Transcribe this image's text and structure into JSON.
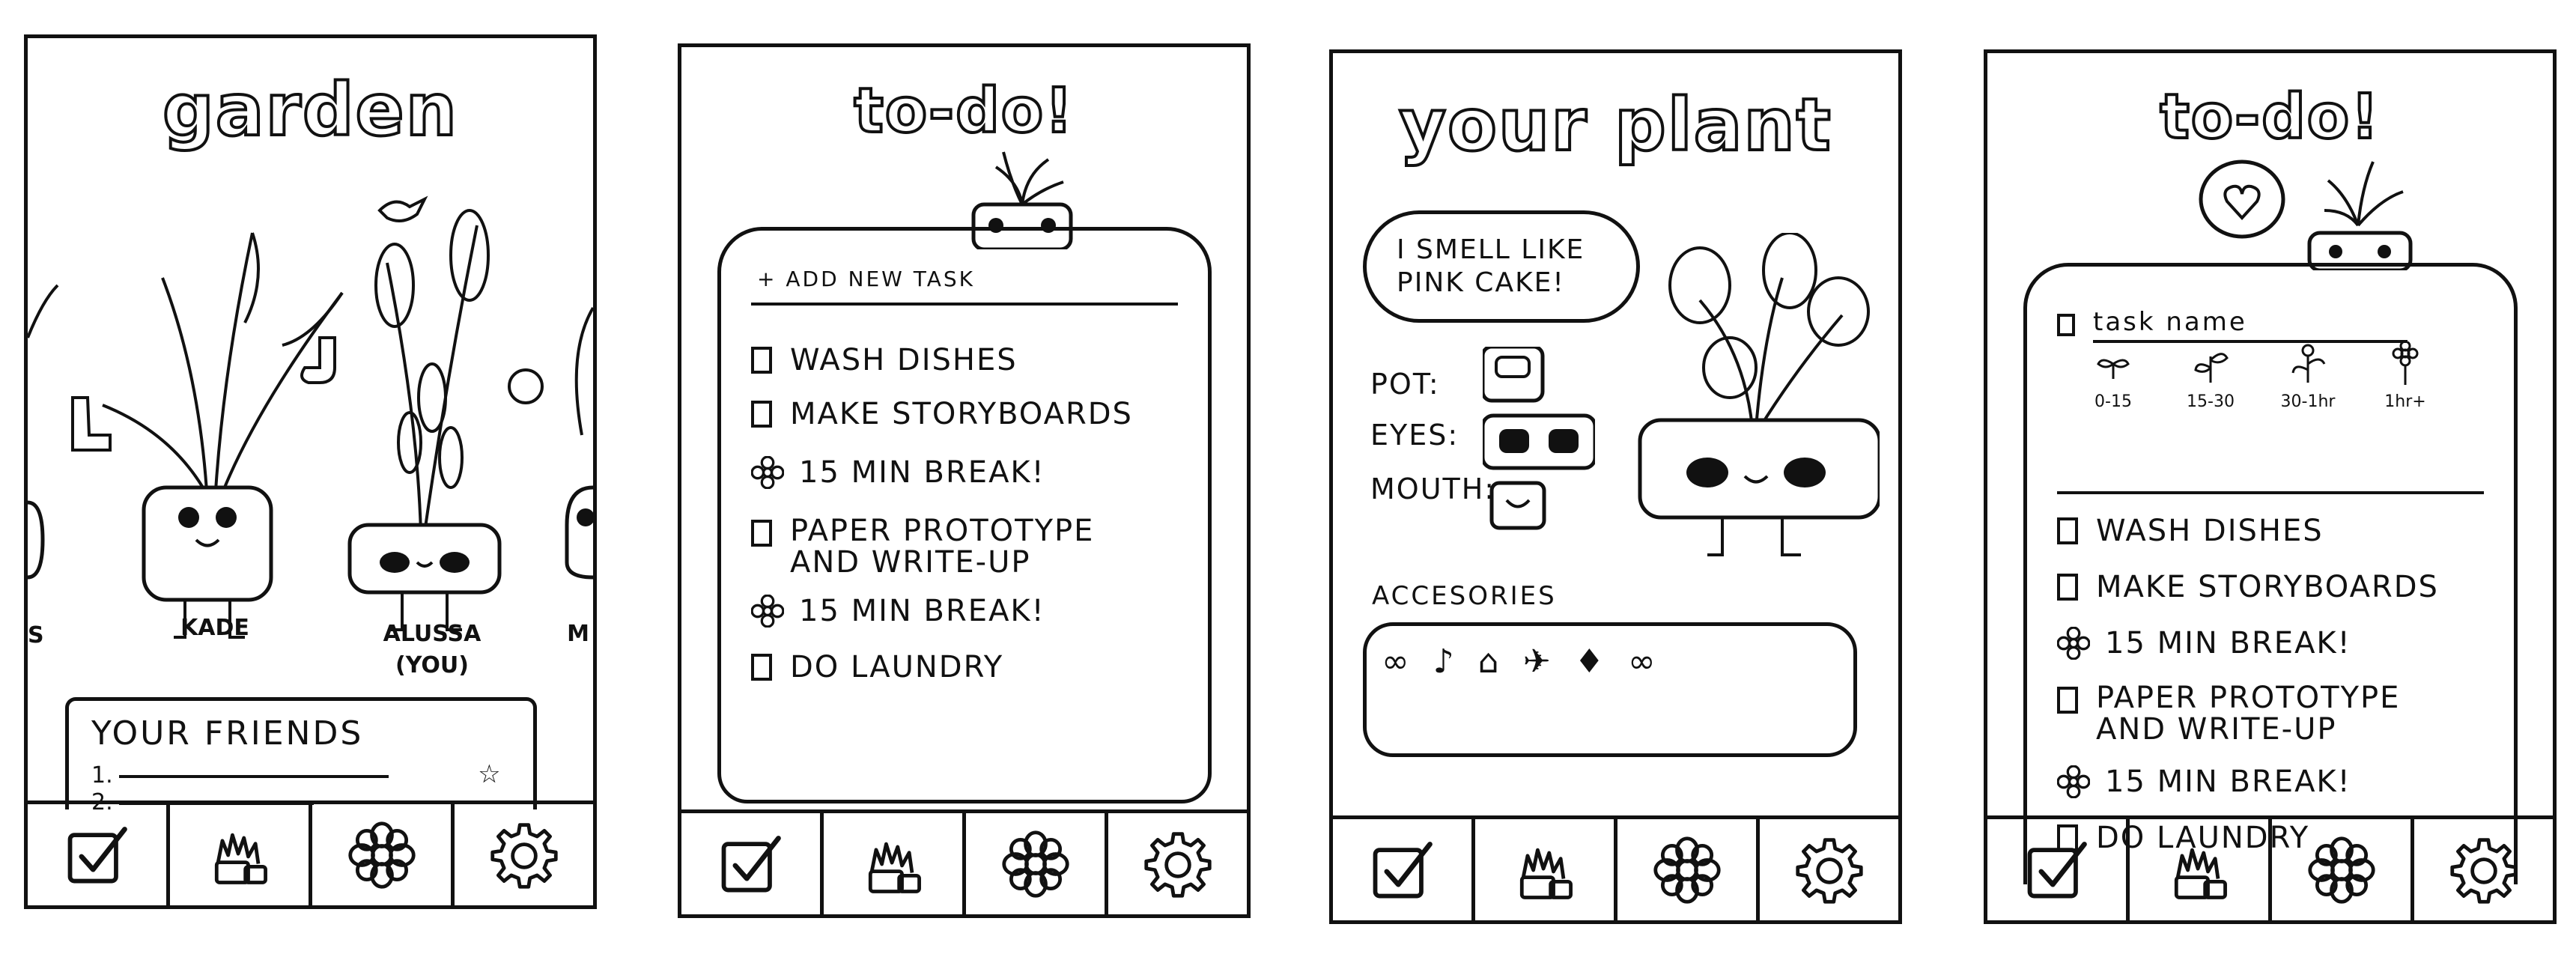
{
  "nav": [
    {
      "name": "todo",
      "icon": "checkbox-icon"
    },
    {
      "name": "garden",
      "icon": "plants-icon"
    },
    {
      "name": "plant",
      "icon": "flower-icon"
    },
    {
      "name": "settings",
      "icon": "gear-icon"
    }
  ],
  "garden": {
    "title": "garden",
    "plant_names": [
      "S",
      "KADE",
      "ALUSSA",
      "(YOU)",
      "M"
    ],
    "friends_title": "YOUR FRIENDS",
    "friend_numbers": [
      "1.",
      "2."
    ]
  },
  "todo": {
    "title": "to-do!",
    "add_task": "+ ADD NEW TASK",
    "tasks": [
      {
        "text": "WASH DISHES",
        "marker": "checkbox"
      },
      {
        "text": "MAKE STORYBOARDS",
        "marker": "checkbox"
      },
      {
        "text": "15 MIN BREAK!",
        "marker": "flower"
      },
      {
        "text": "PAPER PROTOTYPE AND WRITE-UP",
        "marker": "checkbox"
      },
      {
        "text": "15 MIN BREAK!",
        "marker": "flower"
      },
      {
        "text": "DO LAUNDRY",
        "marker": "checkbox"
      }
    ]
  },
  "plant": {
    "title": "your plant",
    "speech": "I SMELL LIKE PINK CAKE!",
    "pot_label": "POT:",
    "eyes_label": "EYES:",
    "mouth_label": "MOUTH:",
    "accessories_title": "ACCESORIES"
  },
  "todo2": {
    "title": "to-do!",
    "task_name": "task name",
    "durations": [
      "0-15",
      "15-30",
      "30-1hr",
      "1hr+"
    ],
    "tasks": [
      {
        "text": "WASH DISHES",
        "marker": "checkbox"
      },
      {
        "text": "MAKE STORYBOARDS",
        "marker": "checkbox"
      },
      {
        "text": "15 MIN BREAK!",
        "marker": "flower"
      },
      {
        "text": "PAPER PROTOTYPE AND WRITE-UP",
        "marker": "checkbox"
      },
      {
        "text": "15 MIN BREAK!",
        "marker": "flower"
      },
      {
        "text": "DO LAUNDRY",
        "marker": "checkbox"
      }
    ]
  }
}
